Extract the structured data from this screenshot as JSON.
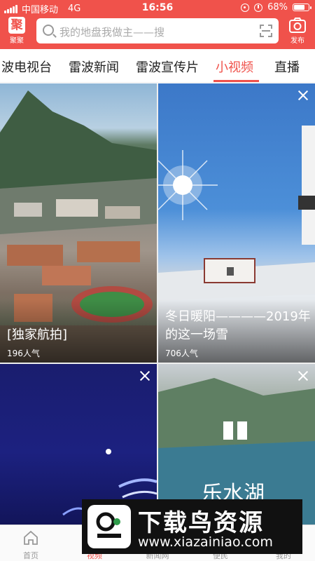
{
  "status_bar": {
    "carrier": "中国移动",
    "network": "4G",
    "time": "16:56",
    "battery": "68%",
    "battery_level": 0.68
  },
  "header": {
    "logo_label": "聚聚",
    "logo_glyph": "聚",
    "search_placeholder": "我的地盘我做主——搜",
    "publish_label": "发布"
  },
  "tabs": [
    {
      "label": "波电视台",
      "active": false
    },
    {
      "label": "雷波新闻",
      "active": false
    },
    {
      "label": "雷波宣传片",
      "active": false
    },
    {
      "label": "小视频",
      "active": true
    },
    {
      "label": "直播",
      "active": false
    }
  ],
  "cards": [
    {
      "title": "[独家航拍]",
      "views": "196人气",
      "closable": false
    },
    {
      "title": "冬日暖阳————2019年的这一场雪",
      "views": "706人气",
      "closable": true
    },
    {
      "title": "",
      "views": "",
      "closable": true
    },
    {
      "title": "乐水湖",
      "views": "",
      "closable": true
    }
  ],
  "bottom_nav": [
    {
      "label": "首页",
      "icon": "home-icon",
      "active": false
    },
    {
      "label": "视频",
      "icon": "video-icon",
      "active": true
    },
    {
      "label": "新闻网",
      "icon": "news-icon",
      "active": false
    },
    {
      "label": "便民",
      "icon": "service-icon",
      "active": false
    },
    {
      "label": "我的",
      "icon": "user-icon",
      "active": false
    }
  ],
  "watermark": {
    "title": "下载鸟资源",
    "url": "www.xiazainiao.com"
  },
  "colors": {
    "brand_red": "#f0524b",
    "text_dark": "#222222",
    "text_muted": "#999999"
  }
}
